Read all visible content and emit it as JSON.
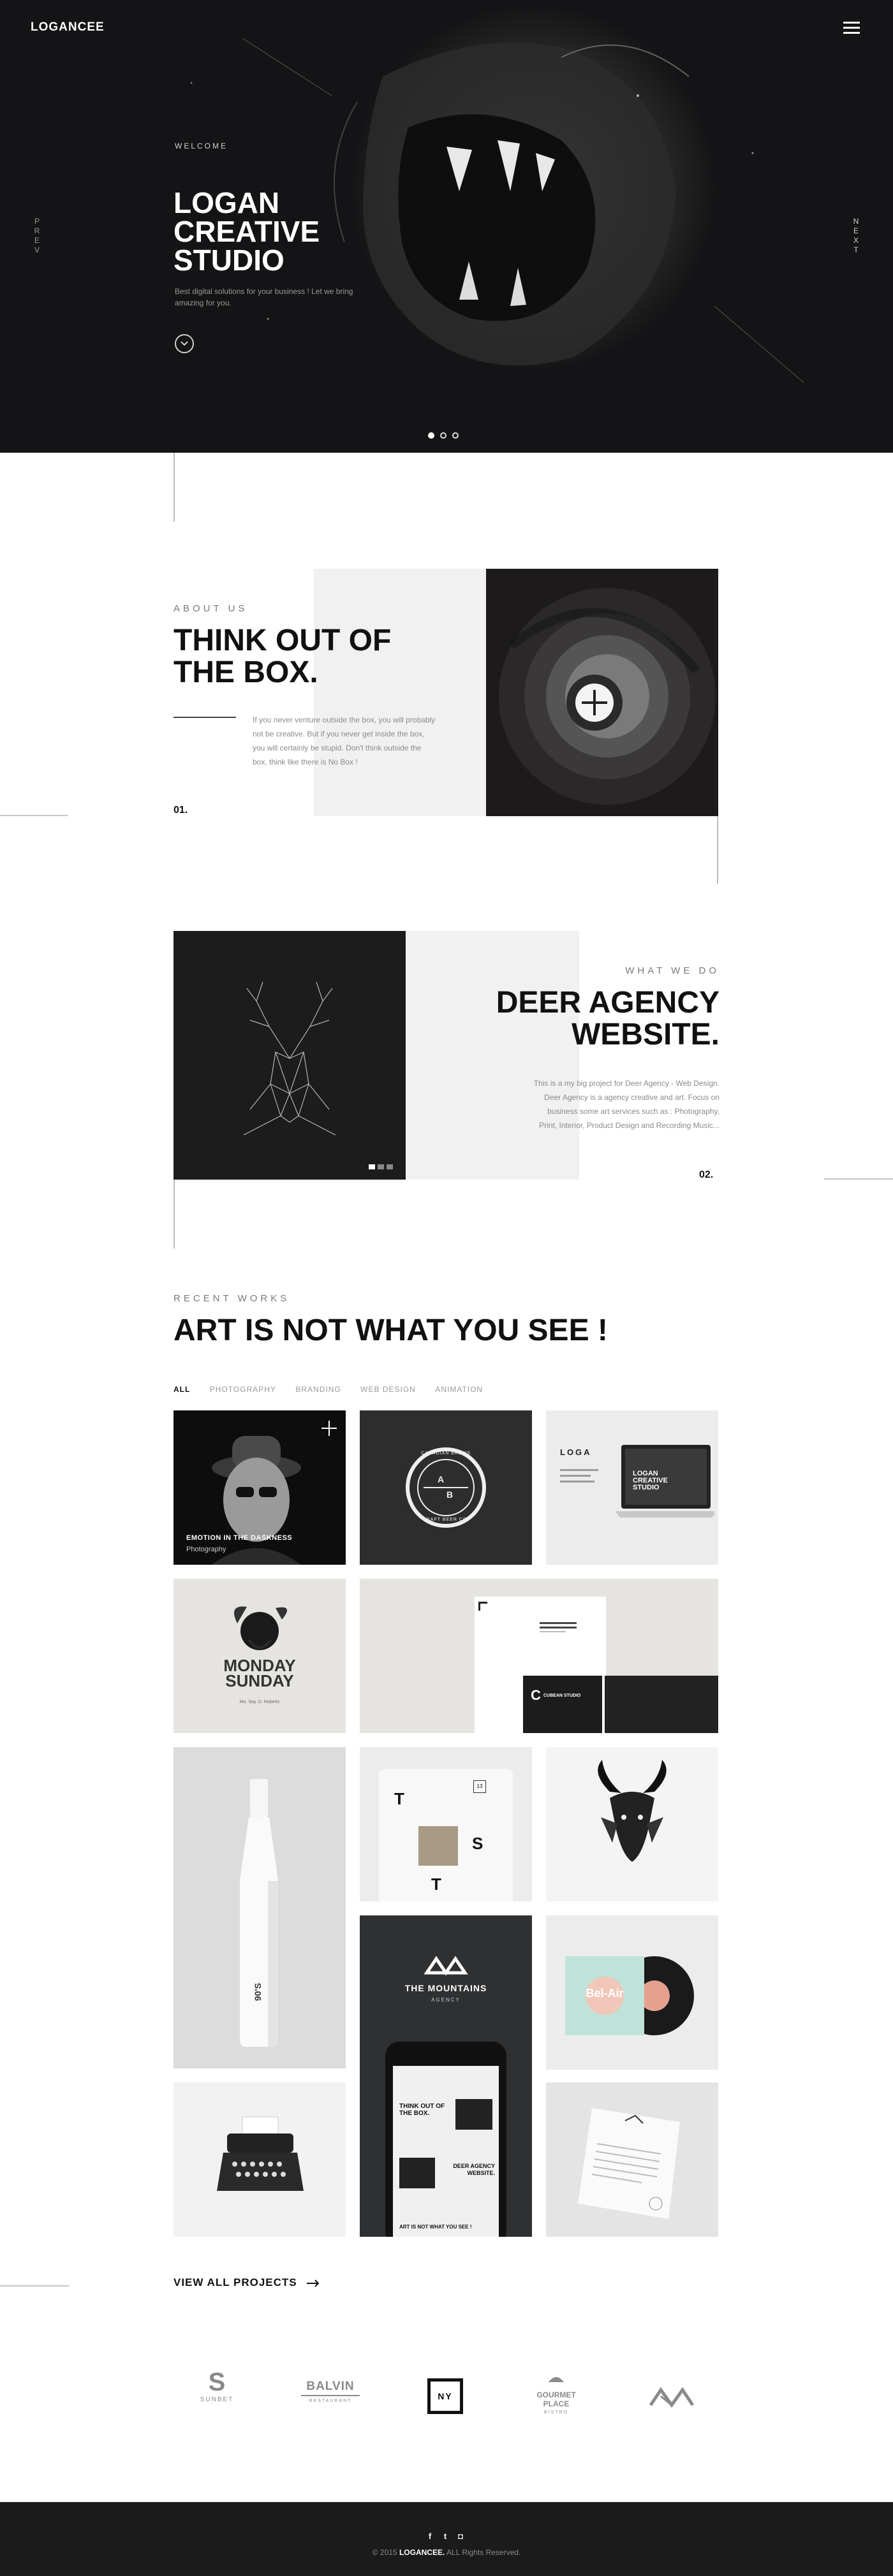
{
  "header": {
    "logo": "LOGANCEE",
    "menu_icon": "hamburger-menu-icon"
  },
  "hero": {
    "welcome": "WELCOME",
    "title_lines": [
      "LOGAN",
      "CREATIVE",
      "STUDIO"
    ],
    "description": "Best digital solutions for your business ! Let we bring amazing for you.",
    "prev_label": "PREV",
    "next_label": "NEXT",
    "scroll_icon": "chevron-down-circle-icon",
    "slides": 3,
    "active_slide": 1
  },
  "about": {
    "eyebrow": "ABOUT US",
    "title_lines": [
      "THINK OUT OF",
      "THE BOX."
    ],
    "body": "If you never venture outside the box, you will probably not be creative. But if you never get inside the box, you will certainly be stupid. Don't think outside the box, think like there is No Box !",
    "number": "01."
  },
  "services": {
    "eyebrow": "WHAT WE DO",
    "title_lines": [
      "DEER AGENCY",
      "WEBSITE."
    ],
    "body": "This is a my big project for Deer Agency - Web Design. Deer Agency is a agency creative and art. Focus on business some art services such as : Photography, Print, Interior, Product Design and Recording Music...",
    "number": "02."
  },
  "works": {
    "eyebrow": "RECENT WORKS",
    "title": "ART IS NOT WHAT YOU SEE !",
    "filters": [
      "ALL",
      "PHOTOGRAPHY",
      "BRANDING",
      "WEB DESIGN",
      "ANIMATION"
    ],
    "active_filter": "ALL",
    "featured": {
      "title": "EMOTION IN THE DASKNESS",
      "category": "Photography"
    },
    "tile_texts": {
      "badge_top": "CANADIAN BREWS",
      "badge_bottom": "CRAFT BEER CO.",
      "badge_a": "A",
      "badge_b": "B",
      "loga": "LOGA",
      "laptop_lines": [
        "LOGAN",
        "CREATIVE",
        "STUDIO"
      ],
      "monday_lines": [
        "MONDAY",
        "SUNDAY"
      ],
      "monday_sub": "Mo. Soy. D. Roberts",
      "cube_card": "CUBEAN STUDIO",
      "cube_letter": "C",
      "bottle_label": "90'S",
      "book_t1": "T",
      "book_s": "S",
      "book_t2": "T",
      "book_badge": "13",
      "mountains_title": "THE MOUNTAINS",
      "mountains_sub": "AGENCY",
      "phone_text_1": "THINK OUT OF THE BOX.",
      "phone_text_2": "DEER AGENCY WEBSITE.",
      "phone_text_3": "ART IS NOT WHAT YOU SEE !",
      "vinyl_text": "Bel-Air"
    },
    "view_all": "VIEW ALL PROJECTS",
    "arrow_icon": "arrow-right-icon"
  },
  "clients": {
    "sunbet": {
      "letter": "S",
      "name": "SUNBET"
    },
    "balvin": {
      "name": "BALVIN",
      "sub": "RESTAURANT"
    },
    "ny": {
      "name": "NY"
    },
    "gourmet": {
      "name": "GOURMET PLACE",
      "sub": "BISTRO"
    },
    "mountains": {
      "icon": "mountains-logo-icon"
    }
  },
  "footer": {
    "social": [
      "facebook-icon",
      "twitter-icon",
      "instagram-icon"
    ],
    "social_glyphs": [
      "f",
      "t",
      "◘"
    ],
    "copyright_pre": "© 2015",
    "copyright_brand": "LOGANCEE.",
    "copyright_post": "ALL Rights Reserved."
  }
}
